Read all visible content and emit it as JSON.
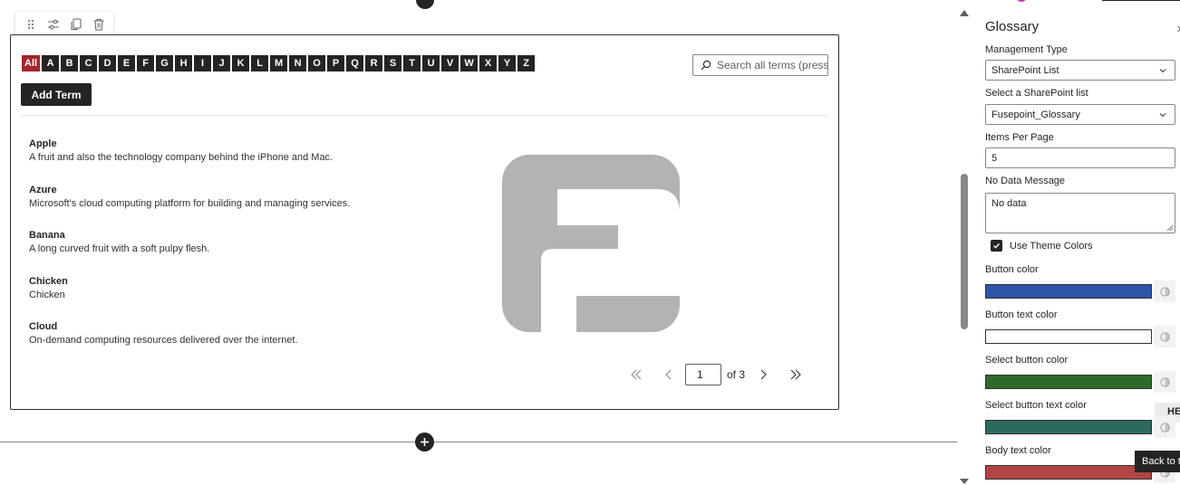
{
  "alphabet": {
    "letters": [
      "All",
      "A",
      "B",
      "C",
      "D",
      "E",
      "F",
      "G",
      "H",
      "I",
      "J",
      "K",
      "L",
      "M",
      "N",
      "O",
      "P",
      "Q",
      "R",
      "S",
      "T",
      "U",
      "V",
      "W",
      "X",
      "Y",
      "Z"
    ],
    "active": "All"
  },
  "search": {
    "placeholder": "Search all terms (press e..."
  },
  "add_term_label": "Add Term",
  "terms": [
    {
      "title": "Apple",
      "description": "A fruit and also the technology company behind the iPhone and Mac."
    },
    {
      "title": "Azure",
      "description": "Microsoft's cloud computing platform for building and managing services."
    },
    {
      "title": "Banana",
      "description": "A long curved fruit with a soft pulpy flesh."
    },
    {
      "title": "Chicken",
      "description": "Chicken"
    },
    {
      "title": "Cloud",
      "description": "On-demand computing resources delivered over the internet."
    }
  ],
  "pagination": {
    "current_page": "1",
    "of_text": "of 3"
  },
  "pane": {
    "title": "Glossary",
    "management_type": {
      "label": "Management Type",
      "value": "SharePoint List"
    },
    "sharepoint_list": {
      "label": "Select a SharePoint list",
      "value": "Fusepoint_Glossary"
    },
    "items_per_page": {
      "label": "Items Per Page",
      "value": "5"
    },
    "no_data_message": {
      "label": "No Data Message",
      "value": "No data"
    },
    "use_theme_colors": {
      "label": "Use Theme Colors",
      "checked": true
    },
    "colors": [
      {
        "label": "Button color",
        "value": "#2b55a8"
      },
      {
        "label": "Button text color",
        "value": "#ffffff"
      },
      {
        "label": "Select button color",
        "value": "#2e6b2a"
      },
      {
        "label": "Select button text color",
        "value": "#2d6b5e"
      },
      {
        "label": "Body text color",
        "value": "#b14545"
      }
    ],
    "tooltip_he": "HE",
    "tooltip_back": "Back to t"
  },
  "theme": {
    "accent_active": "#a4262c",
    "dark": "#252423",
    "logo_gray": "#b3b3b3"
  },
  "icons": {
    "toolbar": [
      "drag-handle-icon",
      "edit-properties-icon",
      "duplicate-icon",
      "delete-icon"
    ],
    "search": "search-icon",
    "pager": [
      "first-page-icon",
      "previous-page-icon",
      "next-page-icon",
      "last-page-icon"
    ],
    "add_section": "plus-icon",
    "reset": "reset-color-icon",
    "chevron": "chevron-down-icon"
  }
}
